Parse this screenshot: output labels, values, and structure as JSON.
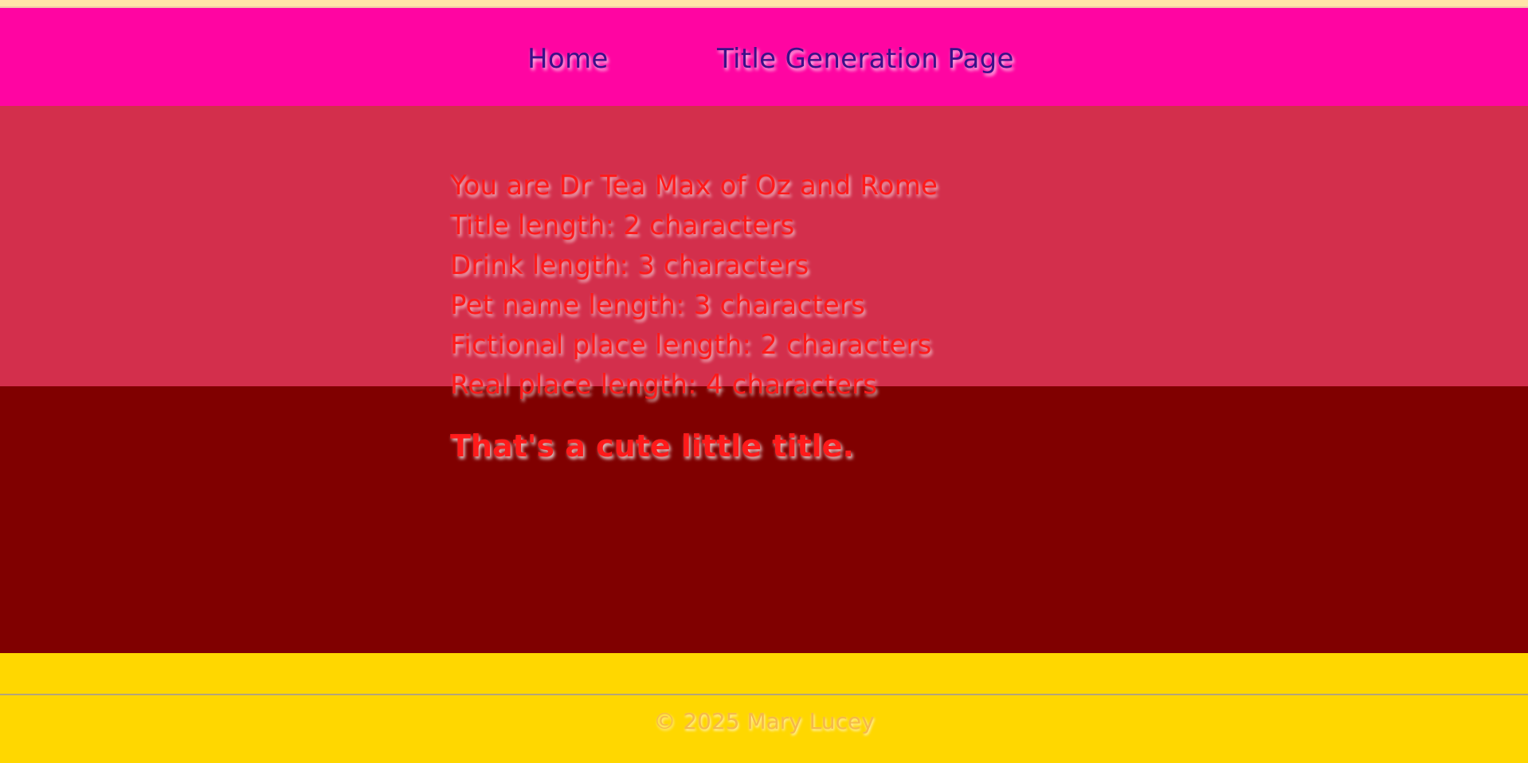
{
  "nav": {
    "home_label": "Home",
    "title_generation_label": "Title Generation Page"
  },
  "result": {
    "title_line": "You are Dr Tea Max of Oz and Rome",
    "lines": [
      "Title length: 2 characters",
      "Drink length: 3 characters",
      "Pet name length: 3 characters",
      "Fictional place length: 2 characters",
      "Real place length: 4 characters"
    ],
    "verdict": "That's a cute little title."
  },
  "footer": {
    "copyright": "© 2025 Mary Lucey"
  },
  "colors": {
    "navbar": "#ff05a2",
    "rose_band": "#d32f4c",
    "maroon_band": "#800000",
    "footer": "#ffd700",
    "nav_text": "#3b1088",
    "result_text": "#ff1a1a",
    "footer_text": "#f5b84a"
  }
}
